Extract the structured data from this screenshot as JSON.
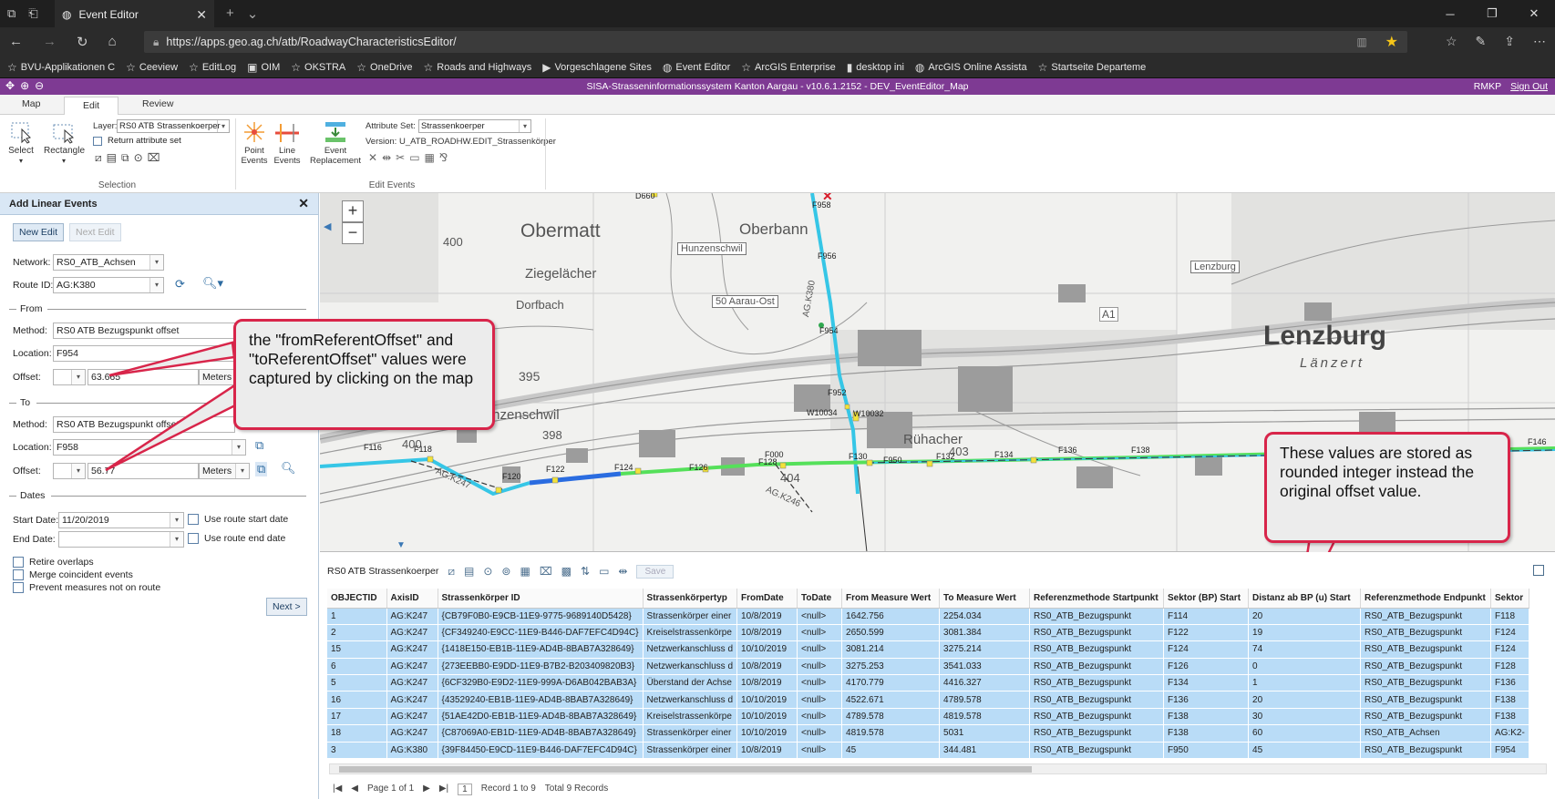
{
  "browser": {
    "tab_title": "Event Editor",
    "url": "https://apps.geo.ag.ch/atb/RoadwayCharacteristicsEditor/",
    "favorites": [
      "BVU-Applikationen C",
      "Ceeview",
      "EditLog",
      "OIM",
      "OKSTRA",
      "OneDrive",
      "Roads and Highways",
      "Vorgeschlagene Sites",
      "Event Editor",
      "ArcGIS Enterprise",
      "desktop ini",
      "ArcGIS Online Assista",
      "Startseite Departeme"
    ]
  },
  "app": {
    "title": "SISA-Strasseninformationssystem Kanton Aargau - v10.6.1.2152 - DEV_EventEditor_Map",
    "user": "RMKP",
    "sign_out": "Sign Out"
  },
  "ribbon": {
    "tabs": [
      "Map",
      "Edit",
      "Review"
    ],
    "active_tab": "Edit",
    "select_label": "Select",
    "rectangle_label": "Rectangle",
    "layer_label": "Layer:",
    "layer_value": "RS0 ATB Strassenkoerper",
    "return_attr": "Return attribute set",
    "selection_group": "Selection",
    "point_events": "Point Events",
    "line_events": "Line Events",
    "event_replacement": "Event Replacement",
    "attribute_set_label": "Attribute Set:",
    "attribute_set_value": "Strassenkoerper",
    "version_text": "Version: U_ATB_ROADHW.EDIT_Strassenkörper",
    "edit_events_group": "Edit Events"
  },
  "left_panel": {
    "title": "Add Linear Events",
    "new_edit": "New Edit",
    "next_edit": "Next Edit",
    "network_label": "Network:",
    "network_value": "RS0_ATB_Achsen",
    "route_label": "Route ID:",
    "route_value": "AG:K380",
    "from_label": "From",
    "method_label": "Method:",
    "from_method": "RS0 ATB Bezugspunkt offset",
    "location_label": "Location:",
    "from_location": "F954",
    "offset_label": "Offset:",
    "from_offset": "63.665",
    "units": "Meters",
    "to_label": "To",
    "to_method": "RS0 ATB Bezugspunkt offset",
    "to_location": "F958",
    "to_offset": "56.77",
    "dates_label": "Dates",
    "start_date_label": "Start Date:",
    "start_date": "11/20/2019",
    "use_start": "Use route start date",
    "end_date_label": "End Date:",
    "end_date": "",
    "use_end": "Use route end date",
    "retire": "Retire overlaps",
    "merge": "Merge coincident events",
    "prevent": "Prevent measures not on route",
    "next": "Next >"
  },
  "map_labels": {
    "places": [
      "Obermatt",
      "Oberbann",
      "Ziegelächer",
      "Hunzenschwil",
      "Lenzburg",
      "Länzert",
      "Rühacher",
      "Dorfbach"
    ],
    "signs": [
      "Hunzenschwil",
      "50 Aarau-Ost",
      "Lenzburg"
    ],
    "elevations": [
      "400",
      "395",
      "398",
      "400",
      "403",
      "404"
    ],
    "road_labels": [
      "A1",
      "AG.K380",
      "AG.K247",
      "AG.K246"
    ],
    "referents": [
      "D660",
      "F958",
      "F956",
      "F954",
      "F952",
      "W10034",
      "W10032",
      "F116",
      "F118",
      "F120",
      "F122",
      "F124",
      "F126",
      "F128",
      "F000",
      "F130",
      "F950",
      "F132",
      "F134",
      "F136",
      "F138",
      "F146"
    ],
    "zoom_in": "+",
    "zoom_out": "−"
  },
  "callouts": {
    "left": "the \"fromReferentOffset\" and \"toReferentOffset\" values were captured by clicking on the map",
    "right": "These values are stored as rounded integer instead the original offset value."
  },
  "table": {
    "layer_name": "RS0 ATB Strassenkoerper",
    "save": "Save",
    "columns": [
      "OBJECTID",
      "AxisID",
      "Strassenkörper ID",
      "Strassenkörpertyp",
      "FromDate",
      "ToDate",
      "From Measure Wert",
      "To Measure Wert",
      "Referenzmethode Startpunkt",
      "Sektor (BP) Start",
      "Distanz ab BP (u) Start",
      "Referenzmethode Endpunkt",
      "Sektor"
    ],
    "rows": [
      [
        "1",
        "AG:K247",
        "{CB79F0B0-E9CB-11E9-9775-9689140D5428}",
        "Strassenkörper einer",
        "10/8/2019",
        "<null>",
        "1642.756",
        "2254.034",
        "RS0_ATB_Bezugspunkt",
        "F114",
        "20",
        "RS0_ATB_Bezugspunkt",
        "F118"
      ],
      [
        "2",
        "AG:K247",
        "{CF349240-E9CC-11E9-B446-DAF7EFC4D94C}",
        "Kreiselstrassenkörpe",
        "10/8/2019",
        "<null>",
        "2650.599",
        "3081.384",
        "RS0_ATB_Bezugspunkt",
        "F122",
        "19",
        "RS0_ATB_Bezugspunkt",
        "F124"
      ],
      [
        "15",
        "AG:K247",
        "{1418E150-EB1B-11E9-AD4B-8BAB7A328649}",
        "Netzwerkanschluss d",
        "10/10/2019",
        "<null>",
        "3081.214",
        "3275.214",
        "RS0_ATB_Bezugspunkt",
        "F124",
        "74",
        "RS0_ATB_Bezugspunkt",
        "F124"
      ],
      [
        "6",
        "AG:K247",
        "{273EEBB0-E9DD-11E9-B7B2-B203409820B3}",
        "Netzwerkanschluss d",
        "10/8/2019",
        "<null>",
        "3275.253",
        "3541.033",
        "RS0_ATB_Bezugspunkt",
        "F126",
        "0",
        "RS0_ATB_Bezugspunkt",
        "F128"
      ],
      [
        "5",
        "AG:K247",
        "{6CF329B0-E9D2-11E9-999A-D6AB042BAB3A}",
        "Überstand der Achse",
        "10/8/2019",
        "<null>",
        "4170.779",
        "4416.327",
        "RS0_ATB_Bezugspunkt",
        "F134",
        "1",
        "RS0_ATB_Bezugspunkt",
        "F136"
      ],
      [
        "16",
        "AG:K247",
        "{43529240-EB1B-11E9-AD4B-8BAB7A328649}",
        "Netzwerkanschluss d",
        "10/10/2019",
        "<null>",
        "4522.671",
        "4789.578",
        "RS0_ATB_Bezugspunkt",
        "F136",
        "20",
        "RS0_ATB_Bezugspunkt",
        "F138"
      ],
      [
        "17",
        "AG:K247",
        "{51AE42D0-EB1B-11E9-AD4B-8BAB7A328649}",
        "Kreiselstrassenkörpe",
        "10/10/2019",
        "<null>",
        "4789.578",
        "4819.578",
        "RS0_ATB_Bezugspunkt",
        "F138",
        "30",
        "RS0_ATB_Bezugspunkt",
        "F138"
      ],
      [
        "18",
        "AG:K247",
        "{C87069A0-EB1D-11E9-AD4B-8BAB7A328649}",
        "Strassenkörper einer",
        "10/10/2019",
        "<null>",
        "4819.578",
        "5031",
        "RS0_ATB_Bezugspunkt",
        "F138",
        "60",
        "RS0_ATB_Achsen",
        "AG:K2-"
      ],
      [
        "3",
        "AG:K380",
        "{39F84450-E9CD-11E9-B446-DAF7EFC4D94C}",
        "Strassenkörper einer",
        "10/8/2019",
        "<null>",
        "45",
        "344.481",
        "RS0_ATB_Bezugspunkt",
        "F950",
        "45",
        "RS0_ATB_Bezugspunkt",
        "F954"
      ]
    ],
    "pager": [
      "Page 1 of 1",
      "1",
      "Record 1 to 9",
      "Total 9 Records"
    ]
  },
  "colors": {
    "app_header": "#7e3a93",
    "selected_row": "#b9dcf7",
    "callout_border": "#d8254a",
    "route_cyan": "#36c6e6",
    "route_green": "#55e05a",
    "route_blue": "#2a6ce0"
  }
}
